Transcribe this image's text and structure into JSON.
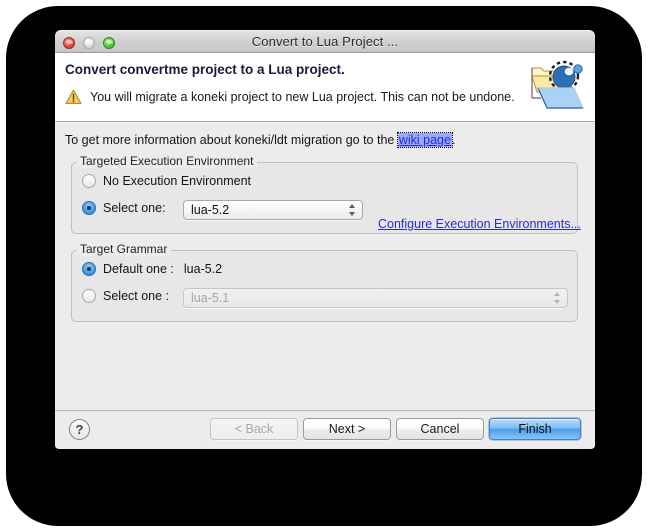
{
  "window": {
    "title": "Convert to Lua Project ...",
    "traffic_lights": {
      "close": "close-button",
      "minimize": "minimize-button",
      "maximize": "maximize-button"
    }
  },
  "header": {
    "heading": "Convert convertme project to a Lua project.",
    "warning_icon": "warning-triangle-icon",
    "warning_text": "You will migrate a koneki project to new Lua project. This can not be undone.",
    "banner_icon": "convert-project-folder-icon"
  },
  "body": {
    "info_prefix": "To get more information about koneki/ldt migration go to the ",
    "info_link": "wiki page",
    "info_suffix": ".",
    "exec_group": {
      "title": "Targeted Execution Environment",
      "option_none_label": "No Execution Environment",
      "option_none_selected": false,
      "option_select_label": "Select one:",
      "option_select_selected": true,
      "combo_value": "lua-5.2",
      "combo_enabled": true,
      "configure_link": "Configure Execution Environments..."
    },
    "grammar_group": {
      "title": "Target Grammar",
      "option_default_label": "Default one :",
      "option_default_selected": true,
      "default_value": "lua-5.2",
      "option_select_label": "Select one :",
      "option_select_selected": false,
      "combo_value": "lua-5.1",
      "combo_enabled": false
    }
  },
  "footer": {
    "help_label": "?",
    "back_label": "< Back",
    "back_enabled": false,
    "next_label": "Next >",
    "next_enabled": true,
    "cancel_label": "Cancel",
    "cancel_enabled": true,
    "finish_label": "Finish",
    "finish_default": true
  },
  "colors": {
    "accent_blue": "#4e9eec",
    "link_blue": "#2b2bd0",
    "link_highlight": "#9aa8ff",
    "window_bg": "#ececec",
    "header_bg": "#ffffff",
    "warning_yellow": "#f0b323"
  }
}
